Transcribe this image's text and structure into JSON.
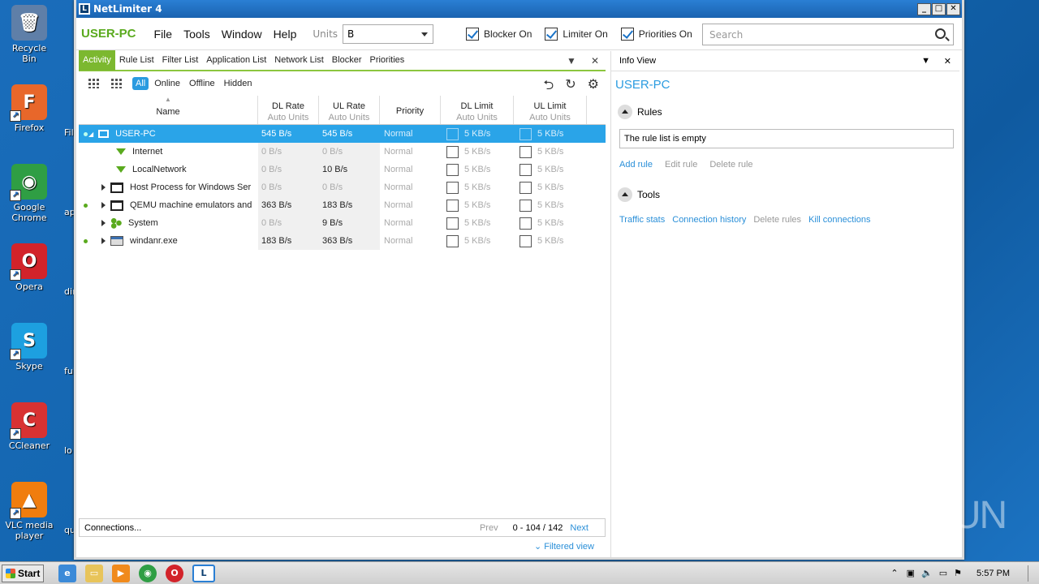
{
  "desktop": {
    "icons": [
      {
        "label": "Recycle Bin",
        "glyph": "🗑",
        "color": "#5f7fa8"
      },
      {
        "label": "Firefox",
        "glyph": "F",
        "color": "#e8672a"
      },
      {
        "label": "Google Chrome",
        "glyph": "◉",
        "color": "#2f9e44"
      },
      {
        "label": "Opera",
        "glyph": "O",
        "color": "#d2232a"
      },
      {
        "label": "Skype",
        "glyph": "S",
        "color": "#1da0e0"
      },
      {
        "label": "CCleaner",
        "glyph": "C",
        "color": "#d83232"
      },
      {
        "label": "VLC media player",
        "glyph": "▲",
        "color": "#f07d0e"
      }
    ],
    "cut_labels": [
      "Fil",
      "ap",
      "dir",
      "ful",
      "lo",
      "qui"
    ]
  },
  "window": {
    "title": "NetLimiter 4",
    "controls": [
      "_",
      "□",
      "✕"
    ]
  },
  "menubar": {
    "host": "USER-PC",
    "menus": [
      "File",
      "Tools",
      "Window",
      "Help"
    ],
    "units_label": "Units",
    "units_value": "B",
    "blocker": "Blocker On",
    "limiter": "Limiter On",
    "priorities": "Priorities On",
    "search_placeholder": "Search"
  },
  "tabs": [
    "Activity",
    "Rule List",
    "Filter List",
    "Application List",
    "Network List",
    "Blocker",
    "Priorities"
  ],
  "filters": [
    "All",
    "Online",
    "Offline",
    "Hidden"
  ],
  "columns": [
    {
      "title": "Name",
      "sub": ""
    },
    {
      "title": "DL Rate",
      "sub": "Auto Units"
    },
    {
      "title": "UL Rate",
      "sub": "Auto Units"
    },
    {
      "title": "Priority",
      "sub": ""
    },
    {
      "title": "DL Limit",
      "sub": "Auto Units"
    },
    {
      "title": "UL Limit",
      "sub": "Auto Units"
    }
  ],
  "rows": [
    {
      "name": "USER-PC",
      "dl": "545 B/s",
      "ul": "545 B/s",
      "priority": "Normal",
      "dl_limit": "5 KB/s",
      "ul_limit": "5 KB/s",
      "online": true,
      "icon": "monitor-icon"
    },
    {
      "name": "Internet",
      "dl": "0 B/s",
      "ul": "0 B/s",
      "priority": "Normal",
      "dl_limit": "5 KB/s",
      "ul_limit": "5 KB/s",
      "online": false,
      "icon": "filter-icon"
    },
    {
      "name": "LocalNetwork",
      "dl": "0 B/s",
      "ul": "10 B/s",
      "priority": "Normal",
      "dl_limit": "5 KB/s",
      "ul_limit": "5 KB/s",
      "online": false,
      "icon": "filter-icon"
    },
    {
      "name": "Host Process for Windows Ser",
      "dl": "0 B/s",
      "ul": "0 B/s",
      "priority": "Normal",
      "dl_limit": "5 KB/s",
      "ul_limit": "5 KB/s",
      "online": false,
      "icon": "window-icon"
    },
    {
      "name": "QEMU machine emulators and",
      "dl": "363 B/s",
      "ul": "183 B/s",
      "priority": "Normal",
      "dl_limit": "5 KB/s",
      "ul_limit": "5 KB/s",
      "online": true,
      "icon": "window-icon"
    },
    {
      "name": "System",
      "dl": "0 B/s",
      "ul": "9 B/s",
      "priority": "Normal",
      "dl_limit": "5 KB/s",
      "ul_limit": "5 KB/s",
      "online": false,
      "icon": "system-icon"
    },
    {
      "name": "windanr.exe",
      "dl": "183 B/s",
      "ul": "363 B/s",
      "priority": "Normal",
      "dl_limit": "5 KB/s",
      "ul_limit": "5 KB/s",
      "online": true,
      "icon": "exe-icon"
    }
  ],
  "bottom": {
    "connections": "Connections...",
    "prev": "Prev",
    "range": "0 - 104 / 142",
    "next": "Next",
    "filtered": "Filtered view"
  },
  "info": {
    "header": "Info View",
    "title": "USER-PC",
    "rules_label": "Rules",
    "rules_empty": "The rule list is empty",
    "rule_links": [
      "Add rule",
      "Edit rule",
      "Delete rule"
    ],
    "tools_label": "Tools",
    "tool_links": [
      "Traffic stats",
      "Connection history",
      "Delete rules",
      "Kill connections"
    ]
  },
  "taskbar": {
    "start": "Start",
    "clock": "5:57 PM"
  },
  "watermark": "ANY RUN",
  "colors": {
    "accent_green": "#7cb82f",
    "accent_blue": "#2a9be0",
    "selected_row": "#2aa4e8"
  }
}
